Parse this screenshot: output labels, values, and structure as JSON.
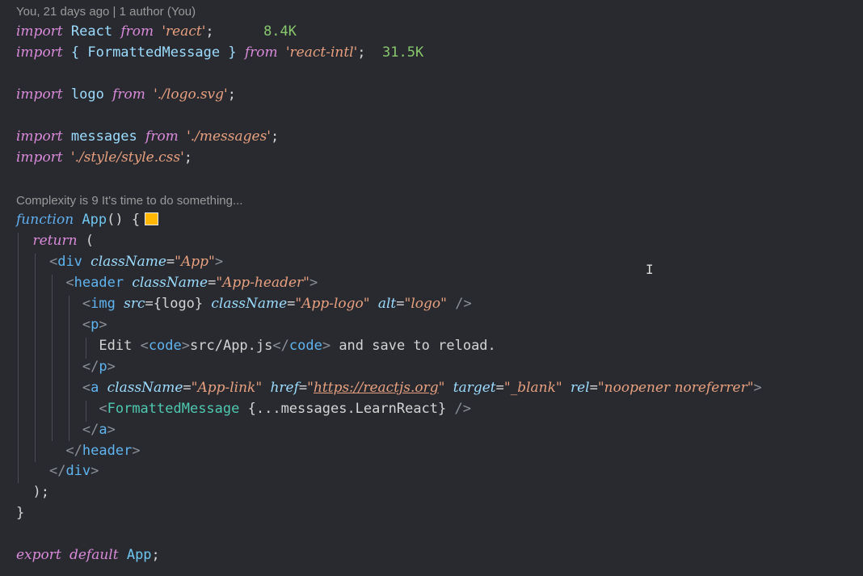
{
  "editor": {
    "blame": "You, 21 days ago | 1 author (You)",
    "complexity": "Complexity is 9 It's time to do something...",
    "import_sizes": {
      "react": "8.4K",
      "react_intl": "31.5K"
    },
    "color_swatch": "#ffb703",
    "lines": {
      "l1": {
        "kw": "import",
        "a": "React",
        "from": "from",
        "str": "'react'",
        "end": ";"
      },
      "l2": {
        "kw": "import",
        "a": "{ FormattedMessage }",
        "from": "from",
        "str": "'react-intl'",
        "end": ";"
      },
      "l3": {
        "kw": "import",
        "a": "logo",
        "from": "from",
        "str": "'./logo.svg'",
        "end": ";"
      },
      "l4": {
        "kw": "import",
        "a": "messages",
        "from": "from",
        "str": "'./messages'",
        "end": ";"
      },
      "l5": {
        "kw": "import",
        "str": "'./style/style.css'",
        "end": ";"
      },
      "l6": {
        "kw": "function",
        "fn": "App",
        "rest": "() {"
      },
      "l7": {
        "kw": "return",
        "rest": "("
      },
      "l8": {
        "open": "<",
        "tag": "div",
        "attr": "className",
        "eq": "=",
        "str": "\"App\"",
        "close": ">"
      },
      "l9": {
        "open": "<",
        "tag": "header",
        "attr": "className",
        "eq": "=",
        "str": "\"App-header\"",
        "close": ">"
      },
      "l10": {
        "open": "<",
        "tag": "img",
        "attr1": "src",
        "eq1": "=",
        "val1": "{logo}",
        "attr2": "className",
        "eq2": "=",
        "str2": "\"App-logo\"",
        "attr3": "alt",
        "eq3": "=",
        "str3": "\"logo\"",
        "close": "/>"
      },
      "l11": {
        "open": "<",
        "tag": "p",
        "close": ">"
      },
      "l12": {
        "t1": "Edit",
        "code_open": "<",
        "code": "code",
        "code_close": ">",
        "t2": "src/App.js",
        "ec_open": "</",
        "ec": "code",
        "ec_close": ">",
        "t3": "and save to reload."
      },
      "l13": {
        "open": "</",
        "tag": "p",
        "close": ">"
      },
      "l14": {
        "open": "<",
        "tag": "a",
        "attr1": "className",
        "eq1": "=",
        "str1": "\"App-link\"",
        "attr2": "href",
        "eq2": "=",
        "q1": "\"",
        "url": "https://reactjs.org",
        "q2": "\"",
        "attr3": "target",
        "eq3": "=",
        "str3": "\"_blank\"",
        "attr4": "rel",
        "eq4": "=",
        "str4": "\"noopener noreferrer\"",
        "close": ">"
      },
      "l15": {
        "open": "<",
        "cmp": "FormattedMessage",
        "expr": "{...messages.LearnReact}",
        "close": "/>"
      },
      "l16": {
        "open": "</",
        "tag": "a",
        "close": ">"
      },
      "l17": {
        "open": "</",
        "tag": "header",
        "close": ">"
      },
      "l18": {
        "open": "</",
        "tag": "div",
        "close": ">"
      },
      "l19": {
        "text": ");"
      },
      "l20": {
        "text": "}"
      },
      "l21": {
        "kw1": "export",
        "kw2": "default",
        "a": "App",
        "end": ";"
      }
    }
  }
}
